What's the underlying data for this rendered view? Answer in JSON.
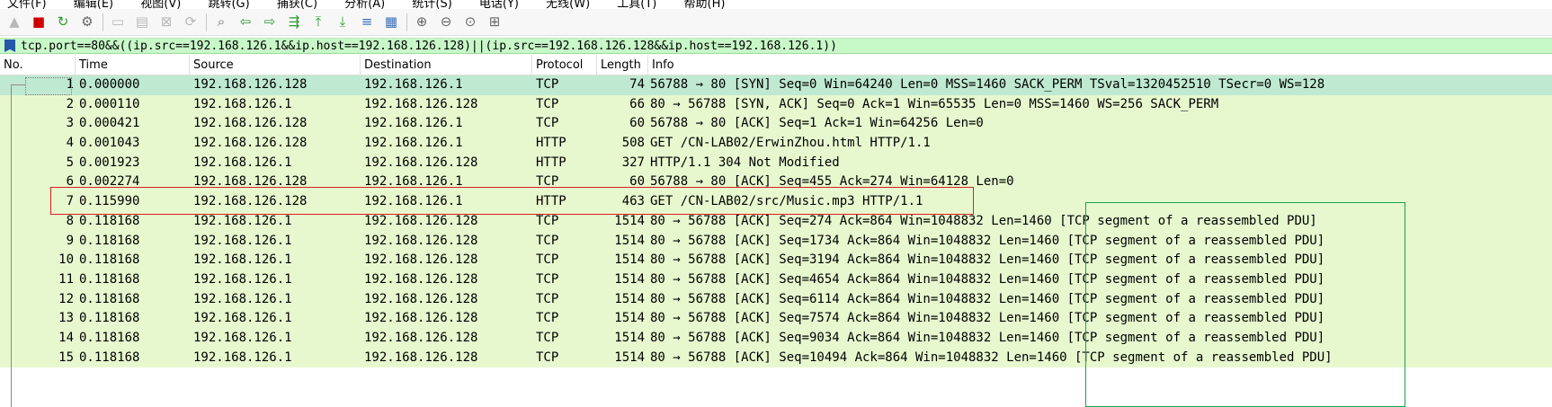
{
  "menus": [
    "文件(F)",
    "编辑(E)",
    "视图(V)",
    "跳转(G)",
    "捕获(C)",
    "分析(A)",
    "统计(S)",
    "电话(Y)",
    "无线(W)",
    "工具(T)",
    "帮助(H)"
  ],
  "toolbar": {
    "icons": [
      "shark-fin-icon",
      "stop-capture-icon",
      "restart-capture-icon",
      "capture-options-icon",
      "open-file-icon",
      "save-file-icon",
      "close-file-icon",
      "reload-file-icon",
      "find-packet-icon",
      "go-back-icon",
      "go-forward-icon",
      "go-to-packet-icon",
      "go-first-packet-icon",
      "go-last-packet-icon",
      "autoscroll-icon",
      "colorize-icon",
      "zoom-in-icon",
      "zoom-out-icon",
      "zoom-normal-icon",
      "resize-columns-icon"
    ]
  },
  "filter": {
    "text": "tcp.port==80&&((ip.src==192.168.126.1&&ip.host==192.168.126.128)||(ip.src==192.168.126.128&&ip.host==192.168.126.1))"
  },
  "columns": {
    "no": "No.",
    "time": "Time",
    "source": "Source",
    "destination": "Destination",
    "protocol": "Protocol",
    "length": "Length",
    "info": "Info"
  },
  "packets": [
    {
      "no": "1",
      "time": "0.000000",
      "source": "192.168.126.128",
      "destination": "192.168.126.1",
      "protocol": "TCP",
      "length": "74",
      "info": "56788 → 80 [SYN] Seq=0 Win=64240 Len=0 MSS=1460 SACK_PERM TSval=1320452510 TSecr=0 WS=128"
    },
    {
      "no": "2",
      "time": "0.000110",
      "source": "192.168.126.1",
      "destination": "192.168.126.128",
      "protocol": "TCP",
      "length": "66",
      "info": "80 → 56788 [SYN, ACK] Seq=0 Ack=1 Win=65535 Len=0 MSS=1460 WS=256 SACK_PERM"
    },
    {
      "no": "3",
      "time": "0.000421",
      "source": "192.168.126.128",
      "destination": "192.168.126.1",
      "protocol": "TCP",
      "length": "60",
      "info": "56788 → 80 [ACK] Seq=1 Ack=1 Win=64256 Len=0"
    },
    {
      "no": "4",
      "time": "0.001043",
      "source": "192.168.126.128",
      "destination": "192.168.126.1",
      "protocol": "HTTP",
      "length": "508",
      "info": "GET /CN-LAB02/ErwinZhou.html HTTP/1.1"
    },
    {
      "no": "5",
      "time": "0.001923",
      "source": "192.168.126.1",
      "destination": "192.168.126.128",
      "protocol": "HTTP",
      "length": "327",
      "info": "HTTP/1.1 304 Not Modified"
    },
    {
      "no": "6",
      "time": "0.002274",
      "source": "192.168.126.128",
      "destination": "192.168.126.1",
      "protocol": "TCP",
      "length": "60",
      "info": "56788 → 80 [ACK] Seq=455 Ack=274 Win=64128 Len=0"
    },
    {
      "no": "7",
      "time": "0.115990",
      "source": "192.168.126.128",
      "destination": "192.168.126.1",
      "protocol": "HTTP",
      "length": "463",
      "info": "GET /CN-LAB02/src/Music.mp3 HTTP/1.1"
    },
    {
      "no": "8",
      "time": "0.118168",
      "source": "192.168.126.1",
      "destination": "192.168.126.128",
      "protocol": "TCP",
      "length": "1514",
      "info": "80 → 56788 [ACK] Seq=274 Ack=864 Win=1048832 Len=1460 [TCP segment of a reassembled PDU]"
    },
    {
      "no": "9",
      "time": "0.118168",
      "source": "192.168.126.1",
      "destination": "192.168.126.128",
      "protocol": "TCP",
      "length": "1514",
      "info": "80 → 56788 [ACK] Seq=1734 Ack=864 Win=1048832 Len=1460 [TCP segment of a reassembled PDU]"
    },
    {
      "no": "10",
      "time": "0.118168",
      "source": "192.168.126.1",
      "destination": "192.168.126.128",
      "protocol": "TCP",
      "length": "1514",
      "info": "80 → 56788 [ACK] Seq=3194 Ack=864 Win=1048832 Len=1460 [TCP segment of a reassembled PDU]"
    },
    {
      "no": "11",
      "time": "0.118168",
      "source": "192.168.126.1",
      "destination": "192.168.126.128",
      "protocol": "TCP",
      "length": "1514",
      "info": "80 → 56788 [ACK] Seq=4654 Ack=864 Win=1048832 Len=1460 [TCP segment of a reassembled PDU]"
    },
    {
      "no": "12",
      "time": "0.118168",
      "source": "192.168.126.1",
      "destination": "192.168.126.128",
      "protocol": "TCP",
      "length": "1514",
      "info": "80 → 56788 [ACK] Seq=6114 Ack=864 Win=1048832 Len=1460 [TCP segment of a reassembled PDU]"
    },
    {
      "no": "13",
      "time": "0.118168",
      "source": "192.168.126.1",
      "destination": "192.168.126.128",
      "protocol": "TCP",
      "length": "1514",
      "info": "80 → 56788 [ACK] Seq=7574 Ack=864 Win=1048832 Len=1460 [TCP segment of a reassembled PDU]"
    },
    {
      "no": "14",
      "time": "0.118168",
      "source": "192.168.126.1",
      "destination": "192.168.126.128",
      "protocol": "TCP",
      "length": "1514",
      "info": "80 → 56788 [ACK] Seq=9034 Ack=864 Win=1048832 Len=1460 [TCP segment of a reassembled PDU]"
    },
    {
      "no": "15",
      "time": "0.118168",
      "source": "192.168.126.1",
      "destination": "192.168.126.128",
      "protocol": "TCP",
      "length": "1514",
      "info": "80 → 56788 [ACK] Seq=10494 Ack=864 Win=1048832 Len=1460 [TCP segment of a reassembled PDU]"
    }
  ],
  "colors": {
    "row_background": "#e7f8cf",
    "selected_row_background": "#bfe9d0",
    "filter_background": "#c8f7c8",
    "annotation_red": "#d91f1f",
    "annotation_green": "#16a34a"
  }
}
